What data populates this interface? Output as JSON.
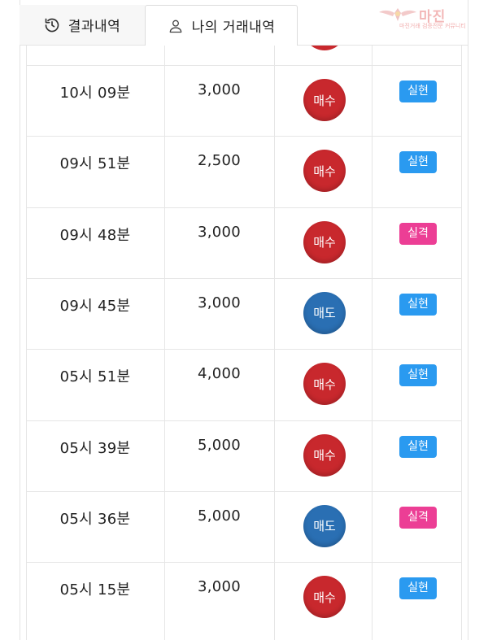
{
  "tabs": [
    {
      "label": "결과내역",
      "icon": "history-icon",
      "active": false
    },
    {
      "label": "나의 거래내역",
      "icon": "user-icon",
      "active": true
    }
  ],
  "logo": {
    "text": "마진",
    "sub": "마진거래 검증전문 커뮤니티"
  },
  "colors": {
    "buy": "#c8282d",
    "sell": "#2a6fb3",
    "success": "#2a9af0",
    "fail": "#ec3e95"
  },
  "rows": [
    {
      "time": "10시 09분",
      "amount": "3,000",
      "side": "매수",
      "side_type": "buy",
      "result": "실현",
      "result_type": "success"
    },
    {
      "time": "09시 51분",
      "amount": "2,500",
      "side": "매수",
      "side_type": "buy",
      "result": "실현",
      "result_type": "success"
    },
    {
      "time": "09시 48분",
      "amount": "3,000",
      "side": "매수",
      "side_type": "buy",
      "result": "실격",
      "result_type": "fail"
    },
    {
      "time": "09시 45분",
      "amount": "3,000",
      "side": "매도",
      "side_type": "sell",
      "result": "실현",
      "result_type": "success"
    },
    {
      "time": "05시 51분",
      "amount": "4,000",
      "side": "매수",
      "side_type": "buy",
      "result": "실현",
      "result_type": "success"
    },
    {
      "time": "05시 39분",
      "amount": "5,000",
      "side": "매수",
      "side_type": "buy",
      "result": "실현",
      "result_type": "success"
    },
    {
      "time": "05시 36분",
      "amount": "5,000",
      "side": "매도",
      "side_type": "sell",
      "result": "실격",
      "result_type": "fail"
    },
    {
      "time": "05시 15분",
      "amount": "3,000",
      "side": "매수",
      "side_type": "buy",
      "result": "실현",
      "result_type": "success"
    }
  ]
}
